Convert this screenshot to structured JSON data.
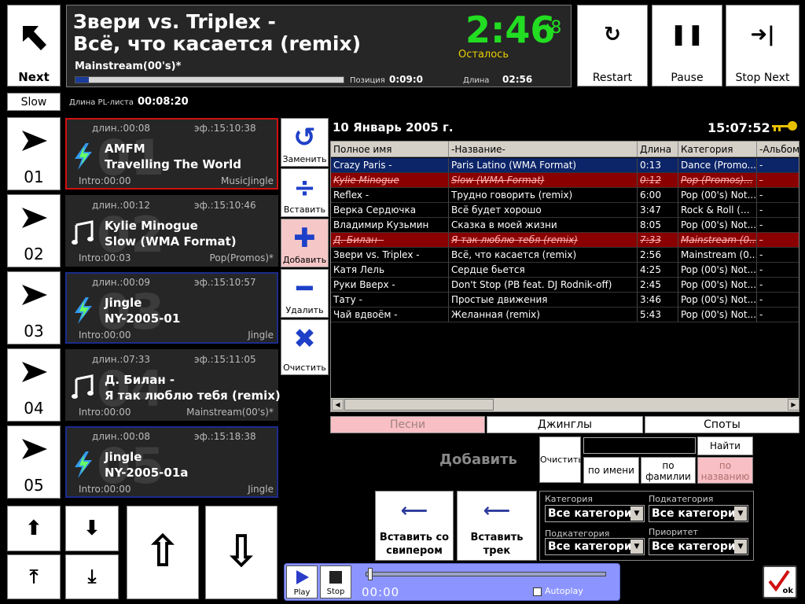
{
  "top_buttons": {
    "next": "Next",
    "restart": "Restart",
    "pause": "Pause",
    "stop_next": "Stop Next",
    "slow": "Slow"
  },
  "now_playing": {
    "line1": "Звери vs. Triplex -",
    "line2": "Всё, что касается (remix)",
    "category": "Mainstream(00's)*",
    "position_label": "Позиция",
    "position": "0:09:0",
    "length_label": "Длина",
    "length": "02:56",
    "time_left": "2:46",
    "time_frac": ":8",
    "remaining_label": "Осталось",
    "progress": 0.05
  },
  "playlist_length": {
    "label": "Длина PL-листа",
    "value": "00:08:20"
  },
  "slots": [
    {
      "num": "01",
      "dur": "длин.:00:08",
      "ef": "эф.:15:10:38",
      "artist": "AMFM",
      "song": "Travelling The World",
      "intro": "Intro:00:00",
      "cat": "MusicJingle",
      "icon": "jingle-icon",
      "wm": "01"
    },
    {
      "num": "02",
      "dur": "длин.:00:12",
      "ef": "эф.:15:10:46",
      "artist": "Kylie Minogue",
      "song": "Slow (WMA Format)",
      "intro": "Intro:00:03",
      "cat": "Pop(Promos)*",
      "icon": "music-note-icon",
      "wm": "02"
    },
    {
      "num": "03",
      "dur": "длин.:00:09",
      "ef": "эф.:15:10:57",
      "artist": "Jingle",
      "song": "NY-2005-01",
      "intro": "Intro:00:00",
      "cat": "Jingle",
      "icon": "jingle-icon",
      "wm": "03"
    },
    {
      "num": "04",
      "dur": "длин.:07:33",
      "ef": "эф.:15:11:05",
      "artist": "Д. Билан -",
      "song": "Я так люблю тебя (remix)",
      "intro": "Intro:00:00",
      "cat": "Mainstream(00's)*",
      "icon": "music-note-icon",
      "wm": "04"
    },
    {
      "num": "05",
      "dur": "длин.:00:08",
      "ef": "эф.:15:18:38",
      "artist": "Jingle",
      "song": "NY-2005-01a",
      "intro": "Intro:00:00",
      "cat": "Jingle",
      "icon": "jingle-icon",
      "wm": "05"
    }
  ],
  "edit_buttons": {
    "replace": "Заменить",
    "insert": "Вставить",
    "add": "Добавить",
    "delete": "Удалить",
    "clear": "Очистить"
  },
  "date": "10 Январь 2005 г.",
  "clock": "15:07:52",
  "table": {
    "headers": [
      "Полное имя",
      "-Название-",
      "Длина",
      "Категория",
      "-Альбом"
    ],
    "rows": [
      [
        "Crazy Paris -",
        "Paris Latino (WMA Format)",
        "0:13",
        "Dance (Promo...",
        "-"
      ],
      [
        "Kylie Minogue",
        "Slow (WMA Format)",
        "0:12",
        "Pop (Promos)...",
        "-"
      ],
      [
        "Reflex -",
        "Трудно говорить (remix)",
        "6:00",
        "Pop (00's) Not...",
        "-"
      ],
      [
        "Верка  Сердючка",
        "Всё будет хорошо",
        "3:47",
        "Rock & Roll (...",
        "-"
      ],
      [
        "Владимир Кузьмин",
        "Сказка в моей жизни",
        "8:05",
        "Pop (00's) Not...",
        "-"
      ],
      [
        "Д. Билан -",
        "Я так люблю тебя (remix)",
        "7:33",
        "Mainstream (0...",
        "-"
      ],
      [
        "Звери vs. Triplex -",
        "Всё, что касается (remix)",
        "2:56",
        "Mainstream (0...",
        "-"
      ],
      [
        "Катя Лель",
        "Сердце бьется",
        "4:25",
        "Pop (00's) Not...",
        "-"
      ],
      [
        "Руки Вверх -",
        "Don't Stop (PB feat. DJ Rodnik-off)",
        "2:45",
        "Pop (00's) Not...",
        "-"
      ],
      [
        "Тату -",
        "Простые движения",
        "3:46",
        "Pop (00's) Not...",
        "-"
      ],
      [
        "Чай вдвоём -",
        "Желанная (remix)",
        "5:43",
        "Pop (00's) Not...",
        "-"
      ]
    ]
  },
  "tabs": [
    "Песни",
    "Джинглы",
    "Споты"
  ],
  "search": {
    "add_label": "Добавить",
    "clear": "Очистить",
    "find": "Найти",
    "value": "",
    "by_name": "по имени",
    "by_surname": "по фамилии",
    "by_title": "по названию"
  },
  "insert_buttons": {
    "sweeper": "Вставить со свипером",
    "track": "Вставить трек"
  },
  "filters": {
    "category_label": "Категория",
    "subcategory_label": "Подкатегория",
    "subcategory2_label": "Подкатегория",
    "priority_label": "Приоритет",
    "all": "Все категории"
  },
  "player": {
    "play": "Play",
    "stop": "Stop",
    "time": "00:00",
    "autoplay": "Autoplay"
  },
  "ok": "ok"
}
